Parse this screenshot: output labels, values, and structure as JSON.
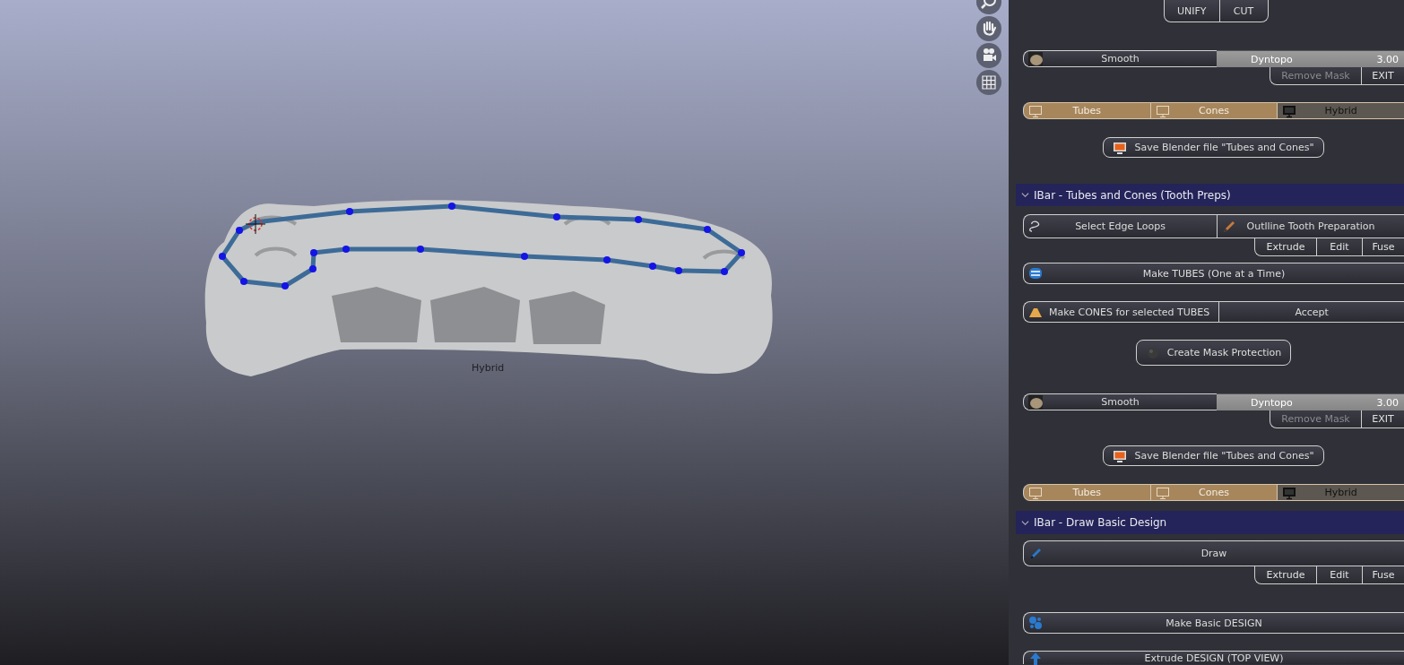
{
  "viewport": {
    "label": "Hybrid"
  },
  "panel": {
    "rows": [
      {
        "kind": "centered",
        "items": [
          {
            "kind": "plain",
            "label": "UNIFY"
          },
          {
            "kind": "plain",
            "label": "CUT"
          }
        ]
      },
      {
        "kind": "bar",
        "items": [
          {
            "kind": "brush",
            "label": "Smooth"
          },
          {
            "kind": "field",
            "label": "Dyntopo",
            "value": "3.00"
          }
        ],
        "sub": [
          {
            "label": "Remove Mask",
            "disabled": true
          },
          {
            "label": "EXIT",
            "disabled": false
          }
        ]
      },
      {
        "kind": "toggles",
        "items": [
          {
            "label": "Tubes",
            "selected": true
          },
          {
            "label": "Cones",
            "selected": true
          },
          {
            "label": "Hybrid",
            "selected": false
          }
        ]
      },
      {
        "kind": "centered",
        "items": [
          {
            "kind": "save",
            "label": "Save Blender file \"Tubes and Cones\""
          }
        ]
      },
      {
        "kind": "header",
        "title": "IBar - Tubes and Cones (Tooth Preps)",
        "expanded": true
      },
      {
        "kind": "bar",
        "items": [
          {
            "kind": "loop",
            "label": "Select Edge Loops"
          },
          {
            "kind": "pencil",
            "label": "Outlline Tooth Preparation"
          }
        ],
        "sub": [
          {
            "label": "Extrude",
            "disabled": false
          },
          {
            "label": "Edit",
            "disabled": false
          },
          {
            "label": "Fuse",
            "disabled": false
          }
        ]
      },
      {
        "kind": "bar",
        "items": [
          {
            "kind": "tube",
            "label": "Make TUBES (One at a Time)"
          }
        ]
      },
      {
        "kind": "bar",
        "items": [
          {
            "kind": "cone",
            "label": "Make CONES for selected TUBES"
          },
          {
            "kind": "plain",
            "label": "Accept"
          }
        ]
      },
      {
        "kind": "centered",
        "items": [
          {
            "kind": "sphere",
            "label": "Create Mask Protection"
          }
        ]
      },
      {
        "kind": "bar",
        "items": [
          {
            "kind": "brush",
            "label": "Smooth"
          },
          {
            "kind": "field",
            "label": "Dyntopo",
            "value": "3.00"
          }
        ],
        "sub": [
          {
            "label": "Remove Mask",
            "disabled": true
          },
          {
            "label": "EXIT",
            "disabled": false
          }
        ]
      },
      {
        "kind": "centered",
        "items": [
          {
            "kind": "save",
            "label": "Save Blender file \"Tubes and Cones\""
          }
        ]
      },
      {
        "kind": "toggles",
        "items": [
          {
            "label": "Tubes",
            "selected": true
          },
          {
            "label": "Cones",
            "selected": true
          },
          {
            "label": "Hybrid",
            "selected": false
          }
        ]
      },
      {
        "kind": "header",
        "title": "IBar - Draw Basic Design",
        "expanded": true
      },
      {
        "kind": "bar",
        "items": [
          {
            "kind": "draw",
            "label": "Draw"
          }
        ],
        "sub": [
          {
            "label": "Extrude",
            "disabled": false
          },
          {
            "label": "Edit",
            "disabled": false
          },
          {
            "label": "Fuse",
            "disabled": false
          }
        ]
      },
      {
        "kind": "bar",
        "items": [
          {
            "kind": "dots",
            "label": "Make  Basic DESIGN"
          }
        ]
      },
      {
        "kind": "bar",
        "items": [
          {
            "kind": "arrow",
            "label": "Extrude  DESIGN (TOP VIEW)"
          }
        ]
      }
    ]
  }
}
